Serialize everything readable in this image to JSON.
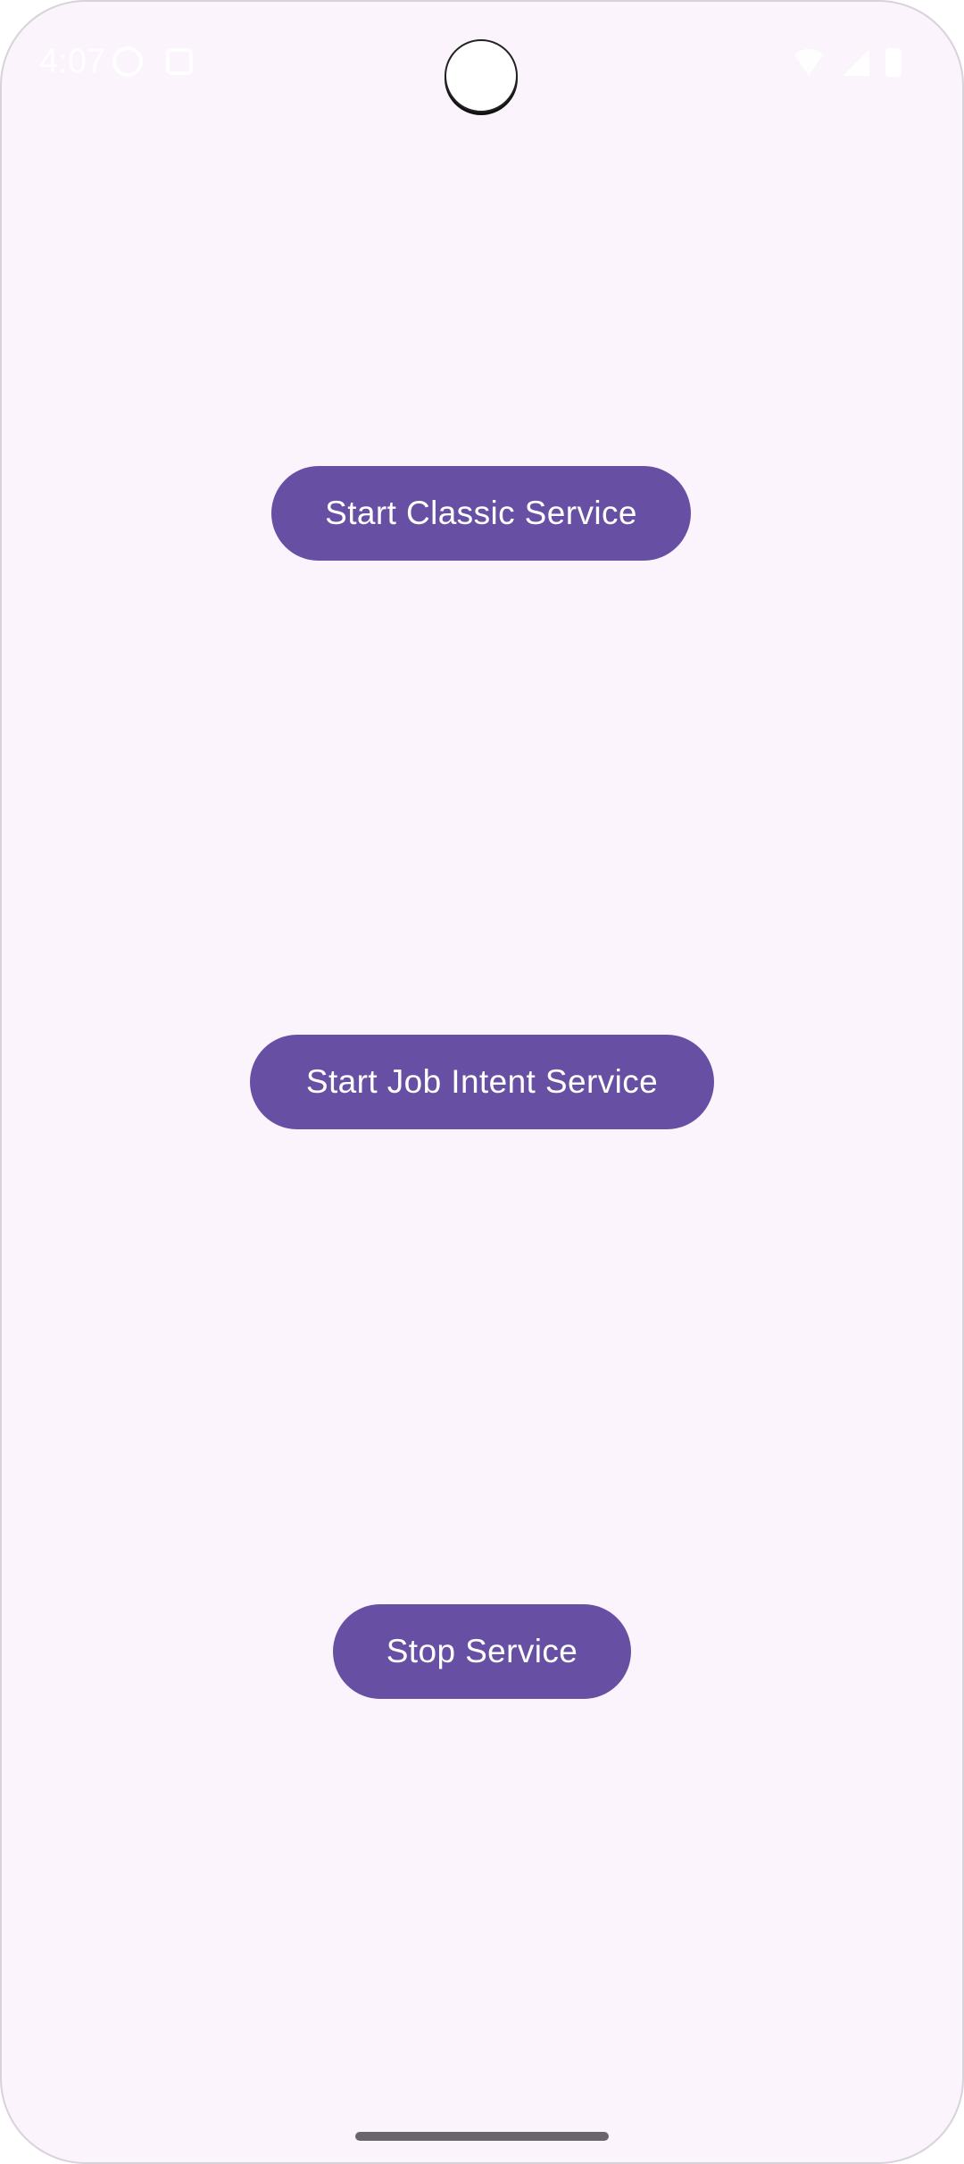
{
  "status_bar": {
    "time": "4:07",
    "left_icons": [
      "info-icon",
      "square-notification-icon"
    ],
    "right_icons": [
      "wifi-icon",
      "signal-icon",
      "battery-icon"
    ]
  },
  "buttons": {
    "start_classic_label": "Start Classic Service",
    "start_job_intent_label": "Start Job Intent Service",
    "stop_label": "Stop Service"
  },
  "colors": {
    "background": "#fcf4fc",
    "button": "#6750a4",
    "button_text": "#ffffff",
    "nav_handle": "#6a656c"
  }
}
